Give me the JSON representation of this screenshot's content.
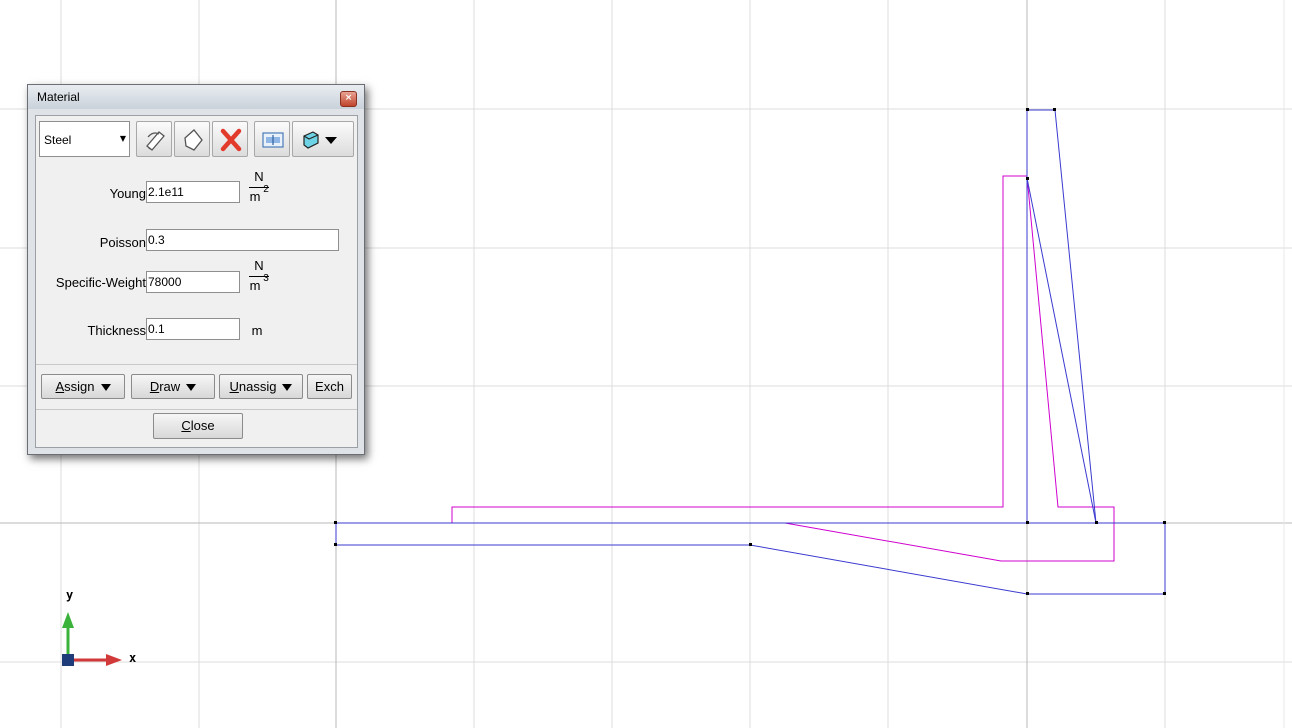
{
  "dialog": {
    "title": "Material",
    "material_select": {
      "value": "Steel"
    },
    "toolbar_icons": [
      "edit-icon",
      "new-material-icon",
      "delete-icon",
      "import-export-icon",
      "properties-menu-icon"
    ],
    "fields": {
      "young": {
        "label": "Young",
        "value": "2.1e11",
        "unit_num": "N",
        "unit_den": "m",
        "unit_exp": "2"
      },
      "poisson": {
        "label": "Poisson",
        "value": "0.3"
      },
      "specific_weight": {
        "label": "Specific-Weight",
        "value": "78000",
        "unit_num": "N",
        "unit_den": "m",
        "unit_exp": "3"
      },
      "thickness": {
        "label": "Thickness",
        "value": "0.1",
        "unit": "m"
      }
    },
    "buttons": {
      "assign": {
        "mnemonic": "A",
        "rest": "ssign"
      },
      "draw": {
        "mnemonic": "D",
        "rest": "raw"
      },
      "unassign": {
        "mnemonic": "U",
        "rest": "nassig"
      },
      "exchange": "Exch",
      "close": {
        "mnemonic": "C",
        "rest": "lose"
      }
    }
  },
  "axes_triad": {
    "x_label": "x",
    "y_label": "y"
  },
  "colors": {
    "geometry_blue": "#3a3ad0",
    "geometry_magenta": "#d000d0",
    "grid": "#dcdcdc",
    "axis_line": "#b8b8b8"
  }
}
